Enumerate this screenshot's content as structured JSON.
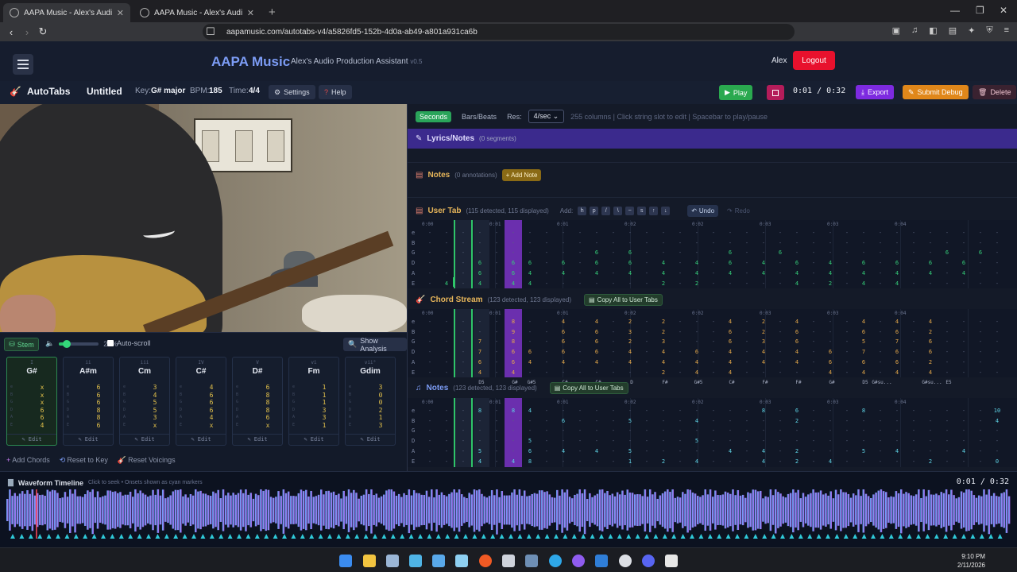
{
  "browser": {
    "tabs": [
      {
        "title": "AAPA Music - Alex's Audio Prod...",
        "active": true
      },
      {
        "title": "AAPA Music - Alex's Audio Productio...",
        "active": false
      }
    ],
    "url": "aapamusic.com/autotabs-v4/a5826fd5-152b-4d0a-ab49-a801a931ca6b"
  },
  "app": {
    "brand": "AAPA Music",
    "tagline": "Alex's Audio Production Assistant",
    "version": "v0.5",
    "user": "Alex",
    "logout": "Logout"
  },
  "toolbar": {
    "section": "AutoTabs",
    "song": "Untitled",
    "key_label": "Key:",
    "key": "G# major",
    "bpm_label": "BPM:",
    "bpm": "185",
    "time_label": "Time:",
    "time_sig": "4/4",
    "settings": "Settings",
    "help": "Help",
    "play": "Play",
    "position": "0:01 / 0:32",
    "export": "Export",
    "submit_debug": "Submit Debug",
    "delete": "Delete"
  },
  "left_controls": {
    "stem": "Stem",
    "volume": "20%",
    "volume_level": 0.2,
    "autoscroll": "Auto-scroll",
    "show_analysis": "Show Analysis",
    "add_chords": "Add Chords",
    "reset_key": "Reset to Key",
    "reset_voicings": "Reset Voicings",
    "edit": "Edit"
  },
  "chords": [
    {
      "numeral": "I",
      "name": "G#",
      "frets": [
        "x",
        "x",
        "x",
        "6",
        "6",
        "4"
      ],
      "selected": true
    },
    {
      "numeral": "ii",
      "name": "A#m",
      "frets": [
        "6",
        "6",
        "6",
        "8",
        "8",
        "6"
      ],
      "selected": false
    },
    {
      "numeral": "iii",
      "name": "Cm",
      "frets": [
        "3",
        "4",
        "5",
        "5",
        "3",
        "x"
      ],
      "selected": false
    },
    {
      "numeral": "IV",
      "name": "C#",
      "frets": [
        "4",
        "6",
        "6",
        "6",
        "4",
        "x"
      ],
      "selected": false
    },
    {
      "numeral": "V",
      "name": "D#",
      "frets": [
        "6",
        "8",
        "8",
        "8",
        "6",
        "x"
      ],
      "selected": false
    },
    {
      "numeral": "vi",
      "name": "Fm",
      "frets": [
        "1",
        "1",
        "1",
        "3",
        "3",
        "1"
      ],
      "selected": false
    },
    {
      "numeral": "vii°",
      "name": "Gdim",
      "frets": [
        "3",
        "0",
        "0",
        "2",
        "1",
        "3"
      ],
      "selected": false
    }
  ],
  "right": {
    "mode_seconds": "Seconds",
    "mode_bars": "Bars/Beats",
    "res_label": "Res:",
    "res_value": "4/sec",
    "hint": "255 columns | Click string slot to edit | Spacebar to play/pause",
    "lyrics_title": "Lyrics/Notes",
    "lyrics_count": "(0 segments)",
    "notes_title": "Notes",
    "notes_count": "(0 annotations)",
    "add_note": "+ Add Note",
    "usertab_title": "User Tab",
    "usertab_count": "(115 detected, 115 displayed)",
    "add_label": "Add:",
    "add_symbols": [
      "h",
      "p",
      "/",
      "\\",
      "~",
      "s",
      "↑",
      "↓"
    ],
    "undo": "Undo",
    "redo": "Redo",
    "chordstream_title": "Chord Stream",
    "chordstream_count": "(123 detected, 123 displayed)",
    "copy_all": "Copy All to User Tabs",
    "notestab_title": "Notes",
    "notestab_count": "(123 detected, 123 displayed)"
  },
  "time_marks": [
    "0:00",
    "0:01",
    "0:01",
    "0:02",
    "0:02",
    "0:03",
    "0:03",
    "0:04"
  ],
  "string_labels": [
    "e",
    "B",
    "G",
    "D",
    "A",
    "E"
  ],
  "user_tab": [
    [
      "-",
      "-",
      "-",
      "-",
      "-",
      "-",
      "-",
      "-",
      "-",
      "-",
      "-",
      "-",
      "-",
      "-",
      "-",
      "-",
      "-",
      "-",
      "-",
      "-",
      "-",
      "-",
      "-",
      "-",
      "-",
      "-",
      "-",
      "-",
      "-",
      "-",
      "-",
      "-",
      "-",
      "-",
      "-"
    ],
    [
      "-",
      "-",
      "-",
      "-",
      "-",
      "-",
      "-",
      "-",
      "-",
      "-",
      "-",
      "-",
      "-",
      "-",
      "-",
      "-",
      "-",
      "-",
      "-",
      "-",
      "-",
      "-",
      "-",
      "-",
      "-",
      "-",
      "-",
      "-",
      "-",
      "-",
      "-",
      "-",
      "-",
      "-",
      "-"
    ],
    [
      "-",
      "-",
      "-",
      "-",
      "-",
      "-",
      "-",
      "-",
      "-",
      "-",
      "6",
      "-",
      "6",
      "-",
      "-",
      "-",
      "-",
      "-",
      "6",
      "-",
      "-",
      "6",
      "-",
      "-",
      "-",
      "-",
      "-",
      "-",
      "-",
      "-",
      "-",
      "6",
      "-",
      "6",
      "-"
    ],
    [
      "-",
      "-",
      "-",
      "6",
      "-",
      "6",
      "6",
      "-",
      "6",
      "-",
      "6",
      "-",
      "6",
      "-",
      "4",
      "-",
      "4",
      "-",
      "6",
      "-",
      "4",
      "-",
      "6",
      "-",
      "4",
      "-",
      "6",
      "-",
      "6",
      "-",
      "6",
      "-",
      "6",
      "-",
      "-"
    ],
    [
      "-",
      "-",
      "-",
      "6",
      "-",
      "6",
      "4",
      "-",
      "4",
      "-",
      "4",
      "-",
      "4",
      "-",
      "4",
      "-",
      "4",
      "-",
      "4",
      "-",
      "4",
      "-",
      "4",
      "-",
      "4",
      "-",
      "4",
      "-",
      "4",
      "-",
      "4",
      "-",
      "4",
      "-",
      "-"
    ],
    [
      "-",
      "4",
      "-",
      "4",
      "-",
      "4",
      "4",
      "-",
      "-",
      "-",
      "-",
      "-",
      "-",
      "-",
      "2",
      "-",
      "2",
      "-",
      "-",
      "-",
      "-",
      "-",
      "4",
      "-",
      "2",
      "-",
      "4",
      "-",
      "4",
      "-",
      "-",
      "-",
      "-",
      "-",
      "-"
    ]
  ],
  "chord_stream": [
    [
      "-",
      "-",
      "-",
      "-",
      "-",
      "8",
      "-",
      "-",
      "4",
      "-",
      "4",
      "-",
      "2",
      "-",
      "2",
      "-",
      "-",
      "-",
      "4",
      "-",
      "2",
      "-",
      "4",
      "-",
      "-",
      "-",
      "4",
      "-",
      "4",
      "-",
      "4",
      "-",
      "-",
      "-",
      "-"
    ],
    [
      "-",
      "-",
      "-",
      "-",
      "-",
      "9",
      "-",
      "-",
      "6",
      "-",
      "6",
      "-",
      "3",
      "-",
      "2",
      "-",
      "-",
      "-",
      "6",
      "-",
      "2",
      "-",
      "6",
      "-",
      "-",
      "-",
      "6",
      "-",
      "6",
      "-",
      "2",
      "-",
      "-",
      "-",
      "-"
    ],
    [
      "-",
      "-",
      "-",
      "7",
      "-",
      "8",
      "-",
      "-",
      "6",
      "-",
      "6",
      "-",
      "2",
      "-",
      "3",
      "-",
      "-",
      "-",
      "6",
      "-",
      "3",
      "-",
      "6",
      "-",
      "-",
      "-",
      "5",
      "-",
      "7",
      "-",
      "6",
      "-",
      "-",
      "-",
      "-"
    ],
    [
      "-",
      "-",
      "-",
      "7",
      "-",
      "6",
      "6",
      "-",
      "6",
      "-",
      "6",
      "-",
      "4",
      "-",
      "4",
      "-",
      "6",
      "-",
      "4",
      "-",
      "4",
      "-",
      "4",
      "-",
      "6",
      "-",
      "7",
      "-",
      "6",
      "-",
      "6",
      "-",
      "-",
      "-",
      "-"
    ],
    [
      "-",
      "-",
      "-",
      "6",
      "-",
      "6",
      "4",
      "-",
      "4",
      "-",
      "4",
      "-",
      "4",
      "-",
      "4",
      "-",
      "4",
      "-",
      "4",
      "-",
      "4",
      "-",
      "4",
      "-",
      "6",
      "-",
      "6",
      "-",
      "6",
      "-",
      "2",
      "-",
      "-",
      "-",
      "-"
    ],
    [
      "-",
      "-",
      "-",
      "4",
      "-",
      "4",
      "-",
      "-",
      "-",
      "-",
      "-",
      "-",
      "-",
      "-",
      "2",
      "-",
      "4",
      "-",
      "4",
      "-",
      "-",
      "-",
      "-",
      "-",
      "4",
      "-",
      "4",
      "-",
      "4",
      "-",
      "4",
      "-",
      "-",
      "-",
      "-"
    ]
  ],
  "chord_names": [
    "",
    "",
    "",
    "D5",
    "",
    "G#",
    "G#5",
    "",
    "C#",
    "",
    "C#",
    "",
    "D",
    "",
    "F#",
    "",
    "G#5",
    "",
    "C#",
    "",
    "F#",
    "",
    "F#",
    "",
    "G#",
    "",
    "D5",
    "G#su...",
    "",
    "",
    "G#su...",
    "E5",
    "",
    "",
    ""
  ],
  "notes_tab": [
    [
      "-",
      "-",
      "-",
      "8",
      "-",
      "8",
      "4",
      "-",
      "-",
      "-",
      "-",
      "-",
      "-",
      "-",
      "-",
      "-",
      "-",
      "-",
      "-",
      "-",
      "8",
      "-",
      "6",
      "-",
      "-",
      "-",
      "8",
      "-",
      "-",
      "-",
      "-",
      "-",
      "-",
      "-",
      "10"
    ],
    [
      "-",
      "-",
      "-",
      "-",
      "-",
      "-",
      "-",
      "-",
      "6",
      "-",
      "-",
      "-",
      "5",
      "-",
      "-",
      "-",
      "4",
      "-",
      "-",
      "-",
      "-",
      "-",
      "2",
      "-",
      "-",
      "-",
      "-",
      "-",
      "-",
      "-",
      "-",
      "-",
      "-",
      "-",
      "4"
    ],
    [
      "-",
      "-",
      "-",
      "-",
      "-",
      "-",
      "-",
      "-",
      "-",
      "-",
      "-",
      "-",
      "-",
      "-",
      "-",
      "-",
      "-",
      "-",
      "-",
      "-",
      "-",
      "-",
      "-",
      "-",
      "-",
      "-",
      "-",
      "-",
      "-",
      "-",
      "-",
      "-",
      "-",
      "-",
      "-"
    ],
    [
      "-",
      "-",
      "-",
      "-",
      "-",
      "-",
      "5",
      "-",
      "-",
      "-",
      "-",
      "-",
      "-",
      "-",
      "-",
      "-",
      "5",
      "-",
      "-",
      "-",
      "-",
      "-",
      "-",
      "-",
      "-",
      "-",
      "-",
      "-",
      "-",
      "-",
      "-",
      "-",
      "-",
      "-",
      "-"
    ],
    [
      "-",
      "-",
      "-",
      "5",
      "-",
      "-",
      "6",
      "-",
      "4",
      "-",
      "4",
      "-",
      "5",
      "-",
      "-",
      "-",
      "-",
      "-",
      "4",
      "-",
      "4",
      "-",
      "2",
      "-",
      "-",
      "-",
      "5",
      "-",
      "4",
      "-",
      "-",
      "-",
      "4",
      "-",
      "-"
    ],
    [
      "-",
      "-",
      "-",
      "4",
      "-",
      "4",
      "8",
      "-",
      "-",
      "-",
      "-",
      "-",
      "1",
      "-",
      "2",
      "-",
      "4",
      "-",
      "-",
      "-",
      "4",
      "-",
      "2",
      "-",
      "4",
      "-",
      "-",
      "-",
      "-",
      "-",
      "2",
      "-",
      "-",
      "-",
      "0"
    ]
  ],
  "waveform": {
    "title": "Waveform Timeline",
    "hint": "Click to seek • Onsets shown as cyan markers",
    "time": "0:01 / 0:32",
    "progress": 0.03
  },
  "taskbar": {
    "time": "9:10 PM",
    "date": "2/11/2026"
  },
  "colors": {
    "accent": "#7c9cf5",
    "play": "#2fc569",
    "lyrics": "#3b2a8d",
    "highlight": "#6b2fae",
    "logout": "#e8112d",
    "export": "#7d2ae0",
    "submit": "#e0871a"
  }
}
